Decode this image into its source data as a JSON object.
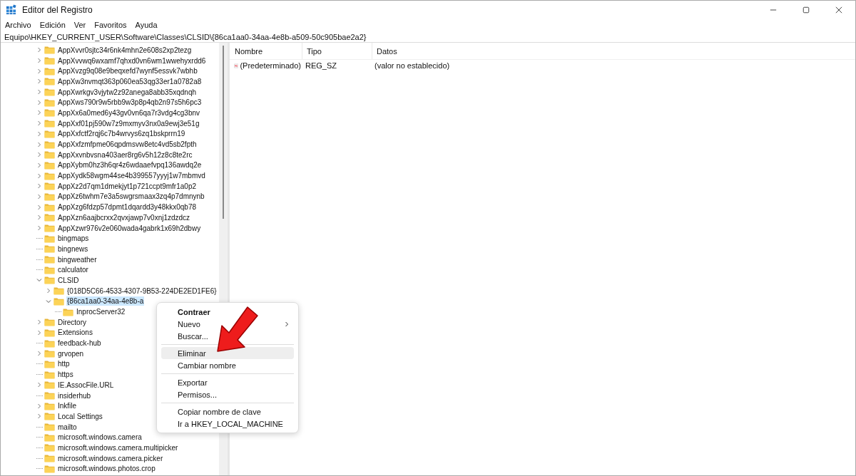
{
  "window": {
    "title": "Editor del Registro"
  },
  "menu_bar": [
    "Archivo",
    "Edición",
    "Ver",
    "Favoritos",
    "Ayuda"
  ],
  "address": "Equipo\\HKEY_CURRENT_USER\\Software\\Classes\\CLSID\\{86ca1aa0-34aa-4e8b-a509-50c905bae2a2}",
  "tree": [
    {
      "label": "AppXvvr0sjtc34r6nk4mhn2e608s2xp2tezg",
      "expandable": true,
      "expanded": false,
      "selected": false
    },
    {
      "label": "AppXvvwq6wxamf7qhxd0vn6wm1wwehyxrdd6",
      "expandable": true,
      "expanded": false,
      "selected": false
    },
    {
      "label": "AppXvzg9q08e9beqxefd7wynf5essvk7wbhb",
      "expandable": true,
      "expanded": false,
      "selected": false
    },
    {
      "label": "AppXw3nvmqt363p060ea53qg33er1a0782a8",
      "expandable": true,
      "expanded": false,
      "selected": false
    },
    {
      "label": "AppXwrkgv3vjytw2z92anega8abb35xqdnqh",
      "expandable": true,
      "expanded": false,
      "selected": false
    },
    {
      "label": "AppXws790r9w5rbb9w3p8p4qb2n97s5h6pc3",
      "expandable": true,
      "expanded": false,
      "selected": false
    },
    {
      "label": "AppXx6a0med6y43gv0vn6qa7r3vdg4cg3bnv",
      "expandable": true,
      "expanded": false,
      "selected": false
    },
    {
      "label": "AppXxf01pj590w7z9mxmyv3nx0a9ewj3e51g",
      "expandable": true,
      "expanded": false,
      "selected": false
    },
    {
      "label": "AppXxfctf2rqj6c7b4wrvys6zq1bskprrn19",
      "expandable": true,
      "expanded": false,
      "selected": false
    },
    {
      "label": "AppXxfzmfpme06qpdmsvw8etc4vd5sb2fpth",
      "expandable": true,
      "expanded": false,
      "selected": false
    },
    {
      "label": "AppXxvnbvsna403aer8rg6v5h12z8c8te2rc",
      "expandable": true,
      "expanded": false,
      "selected": false
    },
    {
      "label": "AppXybm0hz3h6qr4z6wdaaefvpq136awdq2e",
      "expandable": true,
      "expanded": false,
      "selected": false
    },
    {
      "label": "AppXydk58wgm44se4b399557yyyj1w7mbmvd",
      "expandable": true,
      "expanded": false,
      "selected": false
    },
    {
      "label": "AppXz2d7qm1dmekjyt1p721ccpt9mfr1a0p2",
      "expandable": true,
      "expanded": false,
      "selected": false
    },
    {
      "label": "AppXz6twhm7e3a5swgrsmaax3zq4p7dmnynb",
      "expandable": true,
      "expanded": false,
      "selected": false
    },
    {
      "label": "AppXzg6fdzp57dpmt1dqardd3y48kkx0qb78",
      "expandable": true,
      "expanded": false,
      "selected": false
    },
    {
      "label": "AppXzn6aajbcrxx2qvxjawp7v0xnj1zdzdcz",
      "expandable": true,
      "expanded": false,
      "selected": false
    },
    {
      "label": "AppXzwr976v2e060wada4gabrk1x69h2dbwy",
      "expandable": true,
      "expanded": false,
      "selected": false
    },
    {
      "label": "bingmaps",
      "expandable": false,
      "selected": false
    },
    {
      "label": "bingnews",
      "expandable": false,
      "selected": false
    },
    {
      "label": "bingweather",
      "expandable": false,
      "selected": false
    },
    {
      "label": "calculator",
      "expandable": false,
      "selected": false
    },
    {
      "label": "CLSID",
      "expandable": true,
      "expanded": true,
      "selected": false,
      "children": [
        {
          "label": "{018D5C66-4533-4307-9B53-224DE2ED1FE6}",
          "expandable": true,
          "expanded": false,
          "selected": false
        },
        {
          "label": "{86ca1aa0-34aa-4e8b-a",
          "expandable": true,
          "expanded": true,
          "selected": true,
          "children": [
            {
              "label": "InprocServer32",
              "expandable": false,
              "selected": false
            }
          ]
        }
      ]
    },
    {
      "label": "Directory",
      "expandable": true,
      "expanded": false,
      "selected": false
    },
    {
      "label": "Extensions",
      "expandable": true,
      "expanded": false,
      "selected": false
    },
    {
      "label": "feedback-hub",
      "expandable": false,
      "selected": false
    },
    {
      "label": "grvopen",
      "expandable": true,
      "expanded": false,
      "selected": false
    },
    {
      "label": "http",
      "expandable": false,
      "selected": false
    },
    {
      "label": "https",
      "expandable": false,
      "selected": false
    },
    {
      "label": "IE.AssocFile.URL",
      "expandable": true,
      "expanded": false,
      "selected": false
    },
    {
      "label": "insiderhub",
      "expandable": false,
      "selected": false
    },
    {
      "label": "Inkfile",
      "expandable": true,
      "expanded": false,
      "selected": false
    },
    {
      "label": "Local Settings",
      "expandable": true,
      "expanded": false,
      "selected": false
    },
    {
      "label": "mailto",
      "expandable": false,
      "selected": false
    },
    {
      "label": "microsoft.windows.camera",
      "expandable": false,
      "selected": false
    },
    {
      "label": "microsoft.windows.camera.multipicker",
      "expandable": false,
      "selected": false
    },
    {
      "label": "microsoft.windows.camera.picker",
      "expandable": false,
      "selected": false
    },
    {
      "label": "microsoft.windows.photos.crop",
      "expandable": false,
      "selected": false
    }
  ],
  "values_table": {
    "columns": [
      "Nombre",
      "Tipo",
      "Datos"
    ],
    "rows": [
      {
        "name": "(Predeterminado)",
        "type": "REG_SZ",
        "data": "(valor no establecido)"
      }
    ]
  },
  "context_menu": [
    {
      "kind": "item",
      "label": "Contraer",
      "bold": true,
      "hovered": false,
      "submenu": false
    },
    {
      "kind": "item",
      "label": "Nuevo",
      "bold": false,
      "hovered": false,
      "submenu": true
    },
    {
      "kind": "item",
      "label": "Buscar...",
      "bold": false,
      "hovered": false,
      "submenu": false
    },
    {
      "kind": "separator"
    },
    {
      "kind": "item",
      "label": "Eliminar",
      "bold": false,
      "hovered": true,
      "submenu": false
    },
    {
      "kind": "item",
      "label": "Cambiar nombre",
      "bold": false,
      "hovered": false,
      "submenu": false
    },
    {
      "kind": "separator"
    },
    {
      "kind": "item",
      "label": "Exportar",
      "bold": false,
      "hovered": false,
      "submenu": false
    },
    {
      "kind": "item",
      "label": "Permisos...",
      "bold": false,
      "hovered": false,
      "submenu": false
    },
    {
      "kind": "separator"
    },
    {
      "kind": "item",
      "label": "Copiar nombre de clave",
      "bold": false,
      "hovered": false,
      "submenu": false
    },
    {
      "kind": "item",
      "label": "Ir a HKEY_LOCAL_MACHINE",
      "bold": false,
      "hovered": false,
      "submenu": false
    }
  ]
}
